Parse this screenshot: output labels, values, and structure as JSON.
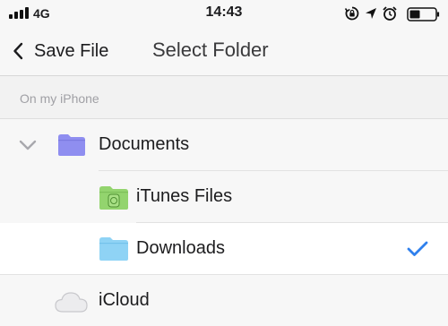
{
  "status_bar": {
    "carrier": "4G",
    "time": "14:43",
    "icons": [
      "signal-bars-icon",
      "rotation-lock-icon",
      "location-arrow-icon",
      "alarm-icon",
      "battery-icon"
    ]
  },
  "nav": {
    "back_label": "Save File",
    "title": "Select Folder"
  },
  "section": {
    "label": "On my iPhone"
  },
  "folders": [
    {
      "label": "Documents",
      "icon": "folder-icon",
      "expanded": true,
      "selected": false,
      "color": "#8f8ef0"
    },
    {
      "label": "iTunes Files",
      "icon": "itunes-folder-icon",
      "selected": false,
      "color": "#93d46e"
    },
    {
      "label": "Downloads",
      "icon": "folder-icon",
      "selected": true,
      "color": "#8fd3f5"
    },
    {
      "label": "iCloud",
      "icon": "cloud-icon",
      "selected": false
    }
  ],
  "colors": {
    "accent": "#2f80ed",
    "background": "#f7f7f7",
    "selected_row": "#ffffff"
  }
}
